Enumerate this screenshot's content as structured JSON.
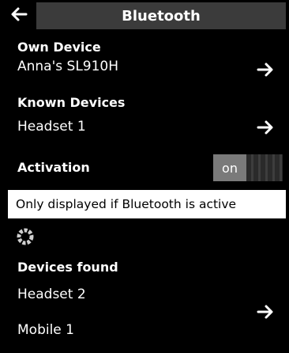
{
  "header": {
    "title": "Bluetooth",
    "back_icon": "arrow-left-icon"
  },
  "own_device": {
    "heading": "Own Device",
    "name": "Anna's SL910H"
  },
  "known_devices": {
    "heading": "Known Devices",
    "items": [
      "Headset 1"
    ]
  },
  "activation": {
    "heading": "Activation",
    "toggle_label": "on",
    "toggle_state": "on"
  },
  "info": {
    "text": "Only displayed if Bluetooth is active"
  },
  "devices_found": {
    "heading": "Devices found",
    "items": [
      "Headset 2",
      "Mobile 1"
    ]
  },
  "icons": {
    "arrow": "arrow-right-icon",
    "spinner": "searching-spinner-icon"
  }
}
